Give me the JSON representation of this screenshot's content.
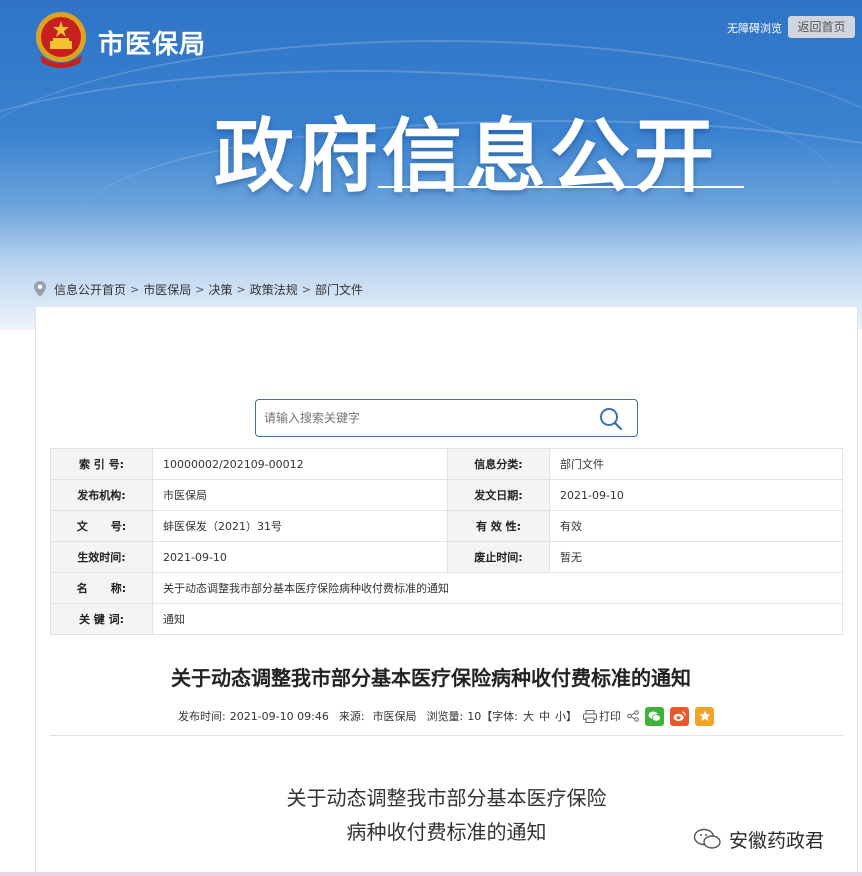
{
  "header": {
    "agency_name": "市医保局",
    "accessibility_link": "无障碍浏览",
    "home_button": "返回首页",
    "banner_title": "政府信息公开"
  },
  "breadcrumb": {
    "items": [
      "信息公开首页",
      "市医保局",
      "决策",
      "政策法规",
      "部门文件"
    ],
    "separator": ">"
  },
  "search": {
    "placeholder": "请输入搜索关键字"
  },
  "meta_table": {
    "index_label": "索 引 号:",
    "index_value": "10000002/202109-00012",
    "category_label": "信息分类:",
    "category_value": "部门文件",
    "publisher_label": "发布机构:",
    "publisher_value": "市医保局",
    "date_label": "发文日期:",
    "date_value": "2021-09-10",
    "docno_label": "文      号:",
    "docno_value": "蚌医保发（2021）31号",
    "validity_label": "有 效 性:",
    "validity_value": "有效",
    "effective_label": "生效时间:",
    "effective_value": "2021-09-10",
    "repeal_label": "废止时间:",
    "repeal_value": "暂无",
    "name_label": "名      称:",
    "name_value": "关于动态调整我市部分基本医疗保险病种收付费标准的通知",
    "keywords_label": "关 键 词:",
    "keywords_value": "通知"
  },
  "article": {
    "title": "关于动态调整我市部分基本医疗保险病种收付费标准的通知",
    "publish_time_label": "发布时间:",
    "publish_time": "2021-09-10 09:46",
    "source_label": "来源:",
    "source": "市医保局",
    "views_label": "浏览量:",
    "views": "10",
    "font_label": "【字体:",
    "font_large": "大",
    "font_medium": "中",
    "font_small": "小",
    "font_close": "】",
    "print_label": "打印",
    "doc_title_line1": "关于动态调整我市部分基本医疗保险",
    "doc_title_line2": "病种收付费标准的通知"
  },
  "watermark": {
    "text": "安徽药政君"
  },
  "colors": {
    "banner_blue": "#2f74c6",
    "search_border": "#3a6fb5",
    "wechat": "#3fb337",
    "weibo": "#e8582b",
    "favorite": "#f2a427"
  }
}
